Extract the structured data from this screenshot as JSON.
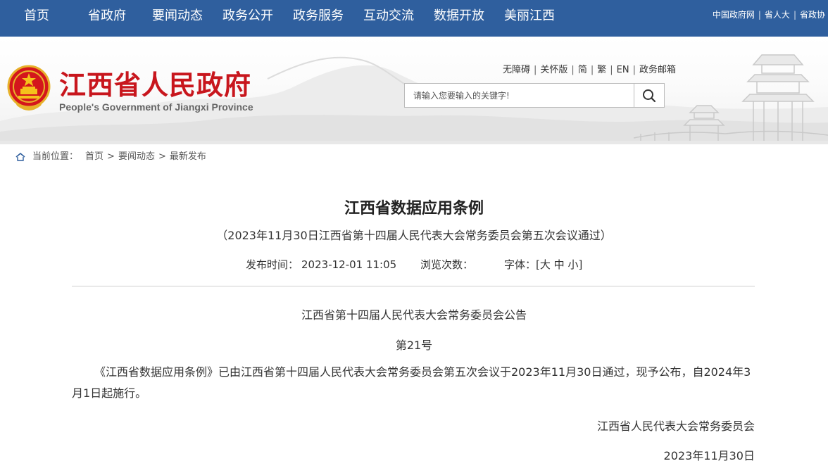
{
  "topnav": {
    "items": [
      "首页",
      "省政府",
      "要闻动态",
      "政务公开",
      "政务服务",
      "互动交流",
      "数据开放",
      "美丽江西"
    ],
    "links": [
      "中国政府网",
      "省人大",
      "省政协"
    ]
  },
  "header": {
    "title": "江西省人民政府",
    "subtitle": "People's Government of Jiangxi Province",
    "util_links": [
      "无障碍",
      "关怀版",
      "简",
      "繁",
      "EN",
      "政务邮箱"
    ],
    "search_placeholder": "请输入您要输入的关键字!"
  },
  "breadcrumb": {
    "label": "当前位置：",
    "items": [
      "首页",
      "要闻动态",
      "最新发布"
    ],
    "separator": ">"
  },
  "article": {
    "title": "江西省数据应用条例",
    "subtitle": "（2023年11月30日江西省第十四届人民代表大会常务委员会第五次会议通过）",
    "publish_label": "发布时间：",
    "publish_time": "2023-12-01 11:05",
    "views_label": "浏览次数：",
    "font_label": "字体：",
    "font_sizes": [
      "大",
      "中",
      "小"
    ],
    "announcement": "江西省第十四届人民代表大会常务委员会公告",
    "number": "第21号",
    "body": "《江西省数据应用条例》已由江西省第十四届人民代表大会常务委员会第五次会议于2023年11月30日通过，现予公布，自2024年3月1日起施行。",
    "signature": "江西省人民代表大会常务委员会",
    "date": "2023年11月30日"
  },
  "colors": {
    "nav_bg": "#2f5f9e",
    "title_red": "#c8161d"
  },
  "icons": [
    "emblem-icon",
    "search-icon",
    "home-icon"
  ]
}
